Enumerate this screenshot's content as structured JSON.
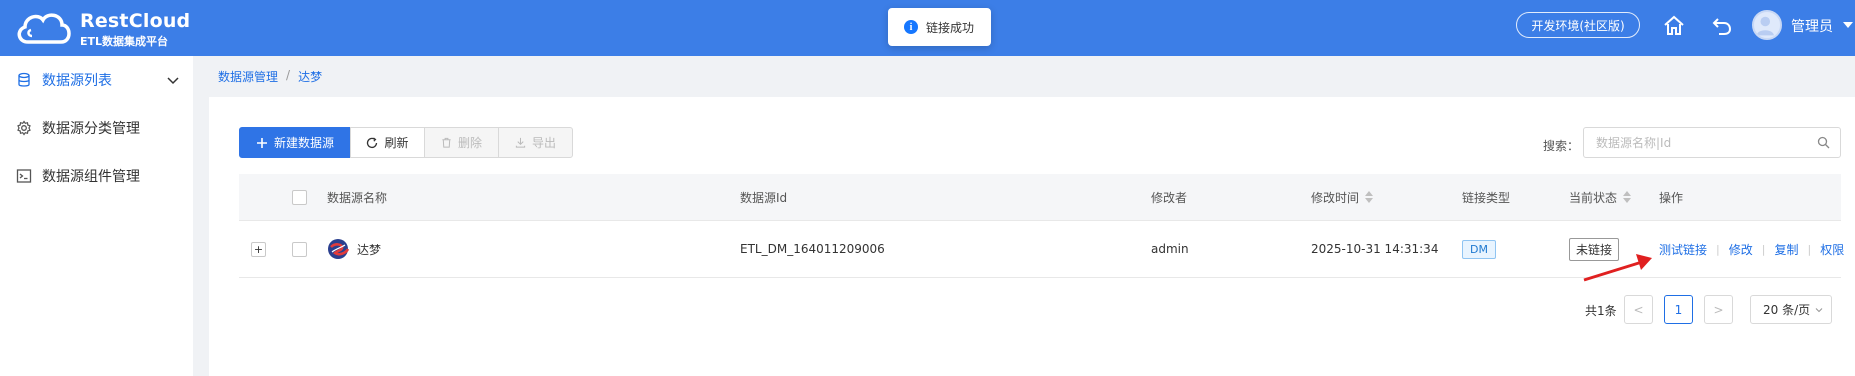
{
  "header": {
    "brand_title": "RestCloud",
    "brand_subtitle": "ETL数据集成平台",
    "toast_text": "链接成功",
    "env_label": "开发环境(社区版)",
    "user_name": "管理员",
    "colors": {
      "bar": "#3c7ee7",
      "accent": "#1f6fe5"
    }
  },
  "sidebar": {
    "items": [
      {
        "label": "数据源列表",
        "icon": "database-icon",
        "active": true
      },
      {
        "label": "数据源分类管理",
        "icon": "gear-icon",
        "active": false
      },
      {
        "label": "数据源组件管理",
        "icon": "terminal-icon",
        "active": false
      }
    ]
  },
  "breadcrumb": {
    "root": "数据源管理",
    "separator": "/",
    "current": "达梦"
  },
  "toolbar": {
    "new_label": "新建数据源",
    "refresh_label": "刷新",
    "delete_label": "删除",
    "export_label": "导出"
  },
  "search": {
    "label": "搜索：",
    "placeholder": "数据源名称|Id",
    "value": ""
  },
  "table": {
    "headers": {
      "name": "数据源名称",
      "id": "数据源Id",
      "modifier": "修改者",
      "modified_time": "修改时间",
      "link_type": "链接类型",
      "status": "当前状态",
      "actions": "操作"
    },
    "rows": [
      {
        "expand": "+",
        "name": "达梦",
        "id": "ETL_DM_164011209006",
        "modifier": "admin",
        "modified_time": "2025-10-31 14:31:34",
        "link_type": "DM",
        "status": "未链接",
        "actions": [
          "测试链接",
          "修改",
          "复制",
          "权限"
        ]
      }
    ]
  },
  "pagination": {
    "total_text": "共1条",
    "prev": "<",
    "current_page": "1",
    "next": ">",
    "page_size": "20 条/页"
  }
}
